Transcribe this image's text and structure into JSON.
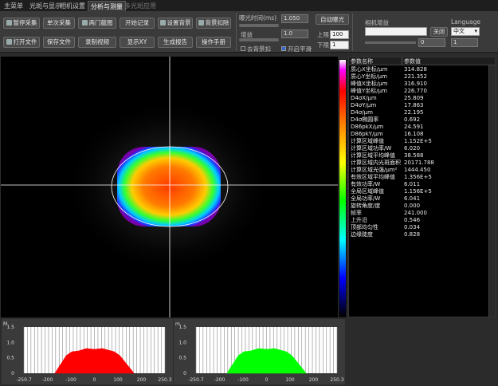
{
  "tabs": [
    "主菜单",
    "光斑与显示",
    "相机设置",
    "分析与测量",
    "多光斑应用"
  ],
  "toolbar": {
    "row1": [
      "暂停采集",
      "单次采集",
      "两门截图",
      "开始记录",
      "设置背景",
      "背景扣除"
    ],
    "row2": [
      "打开文件",
      "保存文件",
      "录制视频",
      "显示XY",
      "生成报告",
      "操作手册"
    ],
    "exposure_label": "曝光时间(ms)",
    "exposure_value": "1.050",
    "auto_exposure": "自动曝光",
    "gain_label": "增益",
    "gain_value": "1.0",
    "upper_label": "上限",
    "upper_value": "100",
    "lower_label": "下限",
    "lower_value": "1",
    "checkbox_left": "去背景扣",
    "checkbox_avg": "开启平滑",
    "camera_label": "相机增益",
    "camera_value": "",
    "camera_button": "关闭",
    "language_label": "Language",
    "language_value": "中文",
    "slider_value": "0",
    "slider_value2": "1"
  },
  "param_table": {
    "headers": [
      "参数名称",
      "参数值"
    ],
    "rows": [
      {
        "name": "质心X坐标/μm",
        "value": "314.828"
      },
      {
        "name": "质心Y坐标/μm",
        "value": "221.352"
      },
      {
        "name": "峰值X坐标/μm",
        "value": "316.910"
      },
      {
        "name": "峰值Y坐标/μm",
        "value": "226.770"
      },
      {
        "name": "D4σX/μm",
        "value": "25.809"
      },
      {
        "name": "D4σY/μm",
        "value": "17.863"
      },
      {
        "name": "D4σ/μm",
        "value": "22.195"
      },
      {
        "name": "D4σ椭圆率",
        "value": "0.692"
      },
      {
        "name": "D86pkX/μm",
        "value": "24.591"
      },
      {
        "name": "D86pkY/μm",
        "value": "16.108"
      },
      {
        "name": "计算区域峰值",
        "value": "1.152E+5"
      },
      {
        "name": "计算区域功率/W",
        "value": "6.020"
      },
      {
        "name": "计算区域平均峰值",
        "value": "38.588"
      },
      {
        "name": "计算区域内光斑面积",
        "value": "20171.788"
      },
      {
        "name": "计算区域光强/μm²",
        "value": "1444.450"
      },
      {
        "name": "有效区域平均峰值",
        "value": "1.356E+5"
      },
      {
        "name": "有效功率/W",
        "value": "6.011"
      },
      {
        "name": "全局区域峰值",
        "value": "1.156E+5"
      },
      {
        "name": "全局功率/W",
        "value": "6.041"
      },
      {
        "name": "旋转角度/度",
        "value": "0.000"
      },
      {
        "name": "帧率",
        "value": "241.000"
      },
      {
        "name": "上升沿",
        "value": "0.546"
      },
      {
        "name": "顶部均匀性",
        "value": "0.034"
      },
      {
        "name": "边缘陡度",
        "value": "0.828"
      }
    ]
  },
  "profile_x": {
    "corner_label": "M",
    "yticks": [
      "1.5",
      "1.0",
      "0.5",
      "0"
    ],
    "xticks": [
      "-250.7",
      "-200",
      "-100",
      "0",
      "100",
      "200",
      "250.3"
    ],
    "color": "#ff0000"
  },
  "profile_y": {
    "corner_label": "m",
    "yticks": [
      "1.5",
      "1.0",
      "0.5",
      "0"
    ],
    "xticks": [
      "-250.7",
      "-200",
      "-100",
      "0",
      "100",
      "200",
      "250.3"
    ],
    "color": "#00ff00"
  },
  "colors": {
    "background": "#2b2b2b",
    "toolbar": "#3a3a3a",
    "accent_blue": "#3366cc"
  }
}
